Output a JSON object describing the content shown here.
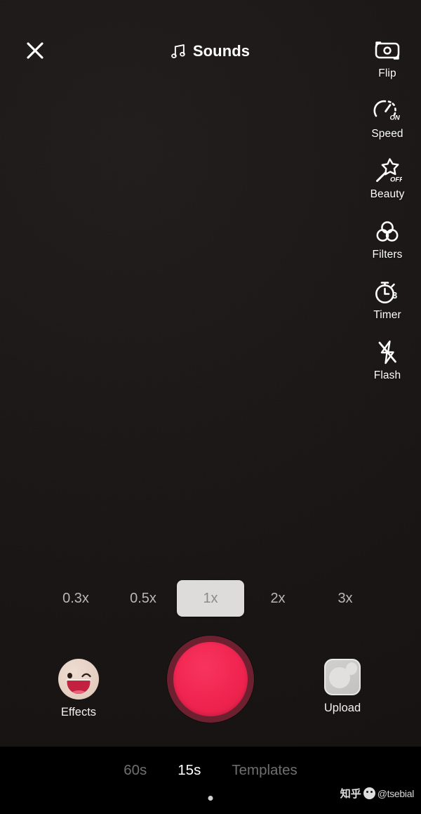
{
  "screen": {
    "app": "TikTok Camera",
    "background_color": "#1a1615",
    "bottom_bar_color": "#000000"
  },
  "topbar": {
    "close_icon": "close-x-icon",
    "sounds_icon": "music-note-icon",
    "sounds_label": "Sounds"
  },
  "toolrail": {
    "items": [
      {
        "icon": "camera-flip-icon",
        "label": "Flip",
        "badge": ""
      },
      {
        "icon": "speedometer-icon",
        "label": "Speed",
        "badge": "ON"
      },
      {
        "icon": "magic-wand-star-icon",
        "label": "Beauty",
        "badge": "OFF"
      },
      {
        "icon": "filters-circles-icon",
        "label": "Filters",
        "badge": ""
      },
      {
        "icon": "stopwatch-icon",
        "label": "Timer",
        "badge": "3"
      },
      {
        "icon": "flash-off-icon",
        "label": "Flash",
        "badge": ""
      }
    ]
  },
  "speed_selector": {
    "options": [
      "0.3x",
      "0.5x",
      "1x",
      "2x",
      "3x"
    ],
    "selected": "1x",
    "selected_bg": "#dedcdb",
    "inactive_color": "#b9b7b6"
  },
  "capture": {
    "effects_label": "Effects",
    "effects_icon": "winking-face-emoji-icon",
    "record_icon": "record-button",
    "record_ring_color": "#6d2030",
    "record_fill_color": "#f02450",
    "upload_label": "Upload",
    "upload_icon": "photo-thumbnail-icon"
  },
  "modebar": {
    "modes": [
      {
        "label": "60s",
        "active": false
      },
      {
        "label": "15s",
        "active": true
      },
      {
        "label": "Templates",
        "active": false
      }
    ],
    "indicator_dot": "active-mode-dot"
  },
  "watermark": {
    "site": "知乎",
    "logo": "zhihu-logo-icon",
    "user": "@tsebial"
  }
}
